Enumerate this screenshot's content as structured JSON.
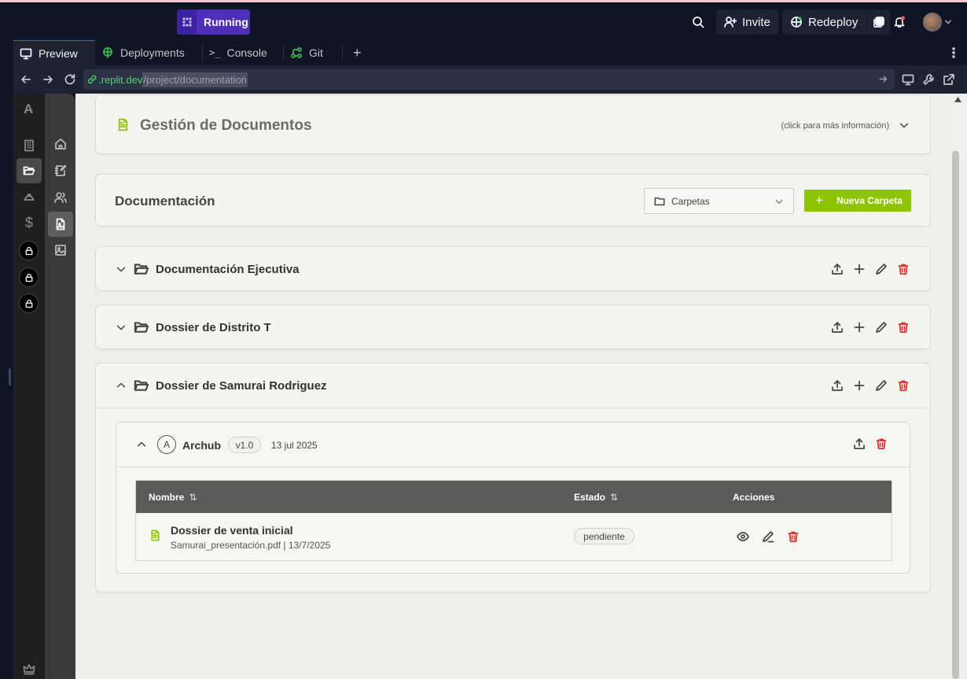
{
  "topbar": {
    "status_label": "Running",
    "invite_label": "Invite",
    "redeploy_label": "Redeploy"
  },
  "tabs": [
    {
      "label": "Preview",
      "icon": "monitor-icon"
    },
    {
      "label": "Deployments",
      "icon": "deploy-icon"
    },
    {
      "label": "Console",
      "icon": "terminal-icon"
    },
    {
      "label": "Git",
      "icon": "git-icon"
    }
  ],
  "url": {
    "host": ".replit.dev",
    "path": "/project/documentation"
  },
  "sidebar": {
    "brand_letter": "A"
  },
  "header_card": {
    "title": "Gestión de Documentos",
    "hint": "(click para más información)"
  },
  "doc_section": {
    "title": "Documentación",
    "select_value": "Carpetas",
    "new_folder_label": "Nueva Carpeta"
  },
  "folders": [
    {
      "name": "Documentación Ejecutiva",
      "expanded": false
    },
    {
      "name": "Dossier de Distrito T",
      "expanded": false
    },
    {
      "name": "Dossier de Samurai Rodriguez",
      "expanded": true
    }
  ],
  "subfolder": {
    "avatar_letter": "A",
    "name": "Archub",
    "version": "v1.0",
    "date": "13 jul 2025"
  },
  "table": {
    "headers": [
      "Nombre",
      "Estado",
      "Acciones"
    ],
    "sort_glyph": "⇅",
    "rows": [
      {
        "title": "Dossier de venta inicial",
        "meta": "Samurai_presentación.pdf | 13/7/2025",
        "status": "pendiente"
      }
    ]
  },
  "colors": {
    "accent_green": "#8fc400",
    "danger_red": "#d9302e",
    "running_purple": "#4d2fb8"
  }
}
